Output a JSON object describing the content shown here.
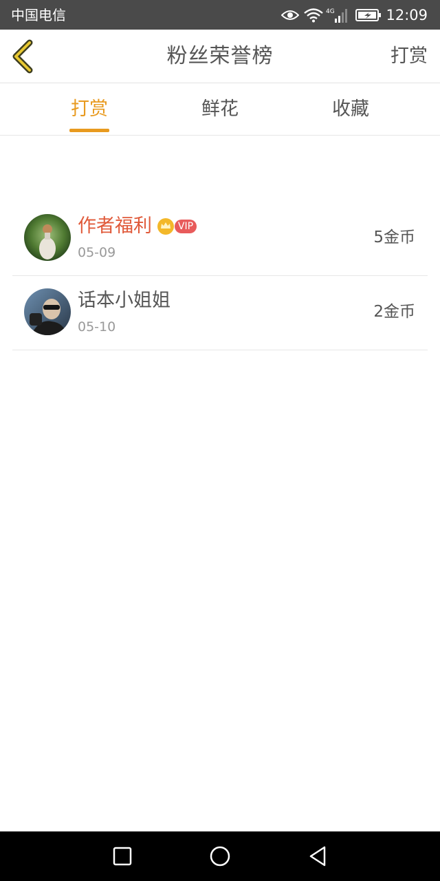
{
  "status_bar": {
    "carrier": "中国电信",
    "signal_label": "4G",
    "time": "12:09"
  },
  "header": {
    "title": "粉丝荣誉榜",
    "right_action": "打赏"
  },
  "tabs": [
    {
      "label": "打赏",
      "active": true
    },
    {
      "label": "鲜花",
      "active": false
    },
    {
      "label": "收藏",
      "active": false
    }
  ],
  "fans": [
    {
      "name": "作者福利",
      "vip": true,
      "vip_label": "VIP",
      "date": "05-09",
      "amount": "5金币"
    },
    {
      "name": "话本小姐姐",
      "vip": false,
      "date": "05-10",
      "amount": "2金币"
    }
  ],
  "colors": {
    "accent": "#e89a1f",
    "vip_name": "#e05a3a",
    "vip_badge": "#e85b5b",
    "status_bar": "#4a4a4a"
  }
}
